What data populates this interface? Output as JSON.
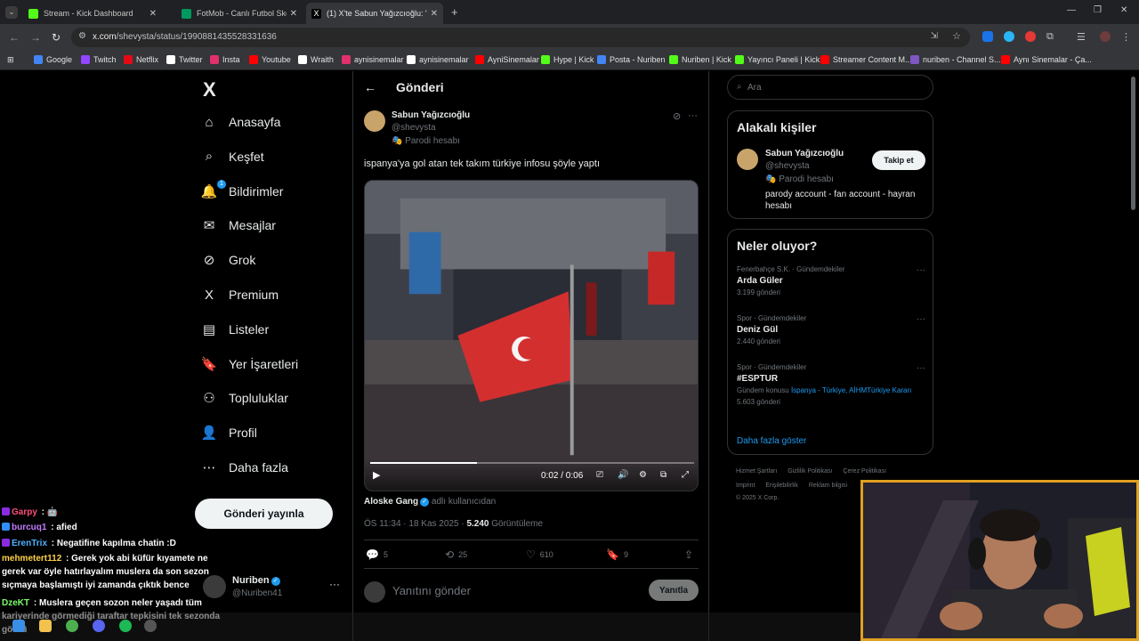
{
  "browser": {
    "tabs": [
      {
        "title": "Stream - Kick Dashboard",
        "color": "#53fc18"
      },
      {
        "title": "FotMob - Canlı Futbol Skorları",
        "color": "#00985f"
      },
      {
        "title": "(1) X'te Sabun Yağızcıoğlu: \"isp...",
        "color": "#ffffff"
      }
    ],
    "url_domain": "x.com",
    "url_path": "/shevysta/status/1990881435528331636",
    "bookmarks": [
      "Google",
      "Twitch",
      "Netflix",
      "Twitter",
      "Insta",
      "Youtube",
      "Wraith",
      "aynisinemalar",
      "aynisinemalar",
      "AyniSinemalar",
      "Hype | Kick",
      "Posta - Nuriben",
      "Nuriben | Kick",
      "Yayıncı Paneli | Kick",
      "Streamer Content M...",
      "nuriben - Channel S...",
      "Aynı Sinemalar - Ça..."
    ]
  },
  "nav": {
    "logo": "X",
    "items": [
      {
        "label": "Anasayfa",
        "icon": "home-icon",
        "glyph": "⌂"
      },
      {
        "label": "Keşfet",
        "icon": "search-icon",
        "glyph": "⌕"
      },
      {
        "label": "Bildirimler",
        "icon": "bell-icon",
        "glyph": "🔔",
        "badge": "1"
      },
      {
        "label": "Mesajlar",
        "icon": "mail-icon",
        "glyph": "✉"
      },
      {
        "label": "Grok",
        "icon": "grok-icon",
        "glyph": "⊘"
      },
      {
        "label": "Premium",
        "icon": "x-premium-icon",
        "glyph": "X"
      },
      {
        "label": "Listeler",
        "icon": "list-icon",
        "glyph": "▤"
      },
      {
        "label": "Yer İşaretleri",
        "icon": "bookmark-icon",
        "glyph": "🔖"
      },
      {
        "label": "Topluluklar",
        "icon": "communities-icon",
        "glyph": "⚇"
      },
      {
        "label": "Profil",
        "icon": "profile-icon",
        "glyph": "👤"
      },
      {
        "label": "Daha fazla",
        "icon": "more-circle-icon",
        "glyph": "⋯"
      }
    ],
    "post_button": "Gönderi yayınla",
    "account": {
      "name": "Nuriben",
      "handle": "@Nuriben41"
    }
  },
  "post": {
    "header_title": "Gönderi",
    "author_name": "Sabun Yağızcıoğlu",
    "author_handle": "@shevysta",
    "author_label": "Parodi hesabı",
    "text": "ispanya'ya gol atan tek takım türkiye infosu şöyle yaptı",
    "video": {
      "time": "0:02 / 0:06",
      "progress": 0.33
    },
    "credit_name": "Aloske Gang",
    "credit_suffix": "adlı kullanıcıdan",
    "timestamp": "ÖS 11:34 · 18 Kas 2025 · ",
    "views_count": "5.240",
    "views_label": "Görüntüleme",
    "actions": {
      "replies": "5",
      "reposts": "25",
      "likes": "610",
      "bookmarks": "9"
    },
    "reply_placeholder": "Yanıtını gönder",
    "reply_button": "Yanıtla"
  },
  "sidebar": {
    "search_placeholder": "Ara",
    "related_title": "Alakalı kişiler",
    "related": {
      "name": "Sabun Yağızcıoğlu",
      "handle": "@shevysta",
      "label": "Parodi hesabı",
      "bio": "parody account - fan account - hayran hesabı",
      "follow": "Takip et"
    },
    "trends_title": "Neler oluyor?",
    "trends": [
      {
        "category": "Fenerbahçe S.K. · Gündemdekiler",
        "name": "Arda Güler",
        "count": "3.199 gönderi"
      },
      {
        "category": "Spor · Gündemdekiler",
        "name": "Deniz Gül",
        "count": "2.440 gönderi"
      },
      {
        "category": "Spor · Gündemdekiler",
        "name": "#ESPTUR",
        "context_prefix": "Gündem konusu",
        "context_links": "İspanya - Türkiye, AİHMTürkiye Kararı",
        "count": "5.603 gönderi"
      }
    ],
    "show_more": "Daha fazla göster",
    "footer": [
      "Hizmet Şartları",
      "Gizlilik Politikası",
      "Çerez Politikası",
      "Imprint",
      "Erişilebilirlik",
      "Reklam bilgisi",
      "© 2025 X Corp."
    ]
  },
  "chat": [
    {
      "user": "Garpy",
      "text": " : 🤖",
      "color": "#ff4d7a",
      "badge": "#8a2be2"
    },
    {
      "user": "burcuq1",
      "text": " : afied",
      "color": "#c27cff",
      "badge": "#2f8fff"
    },
    {
      "user": "ErenTrix",
      "text": " : Negatifine kapılma chatin :D",
      "color": "#4fb0ff",
      "badge": "#8a2be2"
    },
    {
      "user": "mehmetert112",
      "text": " : Gerek yok abi küfür kıyamete ne gerek var öyle hatırlayalım muslera da son sezon sıçmaya başlamıştı iyi zamanda çıktık bence",
      "color": "#ffd24a",
      "badge": ""
    },
    {
      "user": "DzeKT",
      "text": " : Muslera geçen sozon neler yaşadı tüm kariyerinde görmediği taraftar tepkisini tek sezonda gördü",
      "color": "#7cff6b",
      "badge": ""
    }
  ]
}
